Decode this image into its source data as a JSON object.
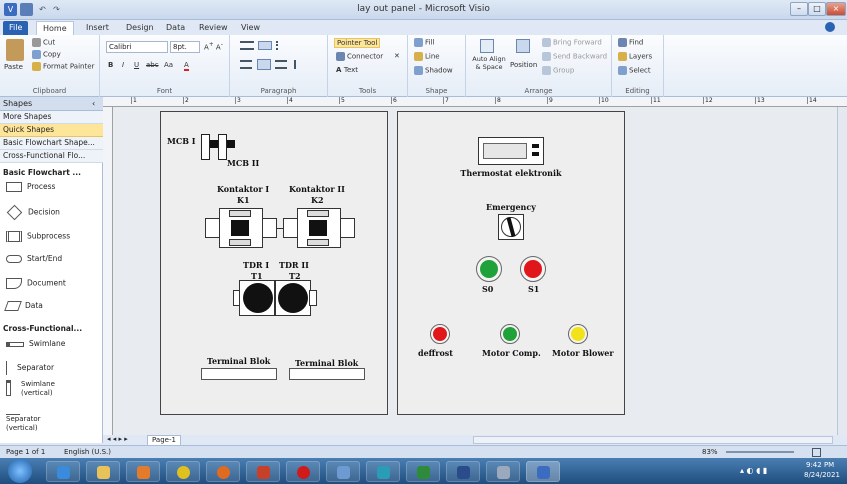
{
  "window": {
    "title": "lay out panel - Microsoft Visio"
  },
  "quick_access": [
    "V",
    "save",
    "undo",
    "redo"
  ],
  "tabs": [
    "File",
    "Home",
    "Insert",
    "Design",
    "Data",
    "Review",
    "View"
  ],
  "ribbon": {
    "clipboard": {
      "label": "Clipboard",
      "paste": "Paste",
      "cut": "Cut",
      "copy": "Copy",
      "format_painter": "Format Painter"
    },
    "font": {
      "label": "Font",
      "family": "Calibri",
      "size": "8pt.",
      "bold": "B",
      "italic": "I",
      "underline": "U",
      "strike": "abc",
      "case": "Aa",
      "color": "A"
    },
    "paragraph": {
      "label": "Paragraph"
    },
    "tools": {
      "label": "Tools",
      "pointer": "Pointer Tool",
      "connector": "Connector",
      "text": "Text"
    },
    "shape": {
      "label": "Shape",
      "fill": "Fill",
      "line": "Line",
      "shadow": "Shadow"
    },
    "arrange": {
      "label": "Arrange",
      "auto_align": "Auto Align & Space",
      "position": "Position",
      "bring_forward": "Bring Forward",
      "send_backward": "Send Backward",
      "group": "Group"
    },
    "editing": {
      "label": "Editing",
      "find": "Find",
      "layers": "Layers",
      "select": "Select"
    }
  },
  "shapes_pane": {
    "header": "Shapes",
    "stencils": [
      "More Shapes",
      "Quick Shapes",
      "Basic Flowchart Shape...",
      "Cross-Functional Flo..."
    ],
    "basic_section": "Basic Flowchart ...",
    "basic_items": [
      "Process",
      "Decision",
      "Subprocess",
      "Start/End",
      "Document",
      "Data"
    ],
    "cross_section": "Cross-Functional...",
    "cross_items": [
      "Swimlane",
      "Separator",
      "Swimlane (vertical)",
      "Separator (vertical)"
    ]
  },
  "ruler_marks": [
    "1",
    "2",
    "3",
    "4",
    "5",
    "6",
    "7",
    "8",
    "9",
    "10",
    "11",
    "12",
    "13",
    "14"
  ],
  "drawing": {
    "panel1": {
      "mcb1": "MCB I",
      "mcb2": "MCB II",
      "k1_title": "Kontaktor I",
      "k1_id": "K1",
      "k2_title": "Kontaktor II",
      "k2_id": "K2",
      "tdr1": "TDR I",
      "t1": "T1",
      "tdr2": "TDR II",
      "t2": "T2",
      "term1": "Terminal Blok",
      "term2": "Terminal Blok"
    },
    "panel2": {
      "thermostat": "Thermostat elektronik",
      "emergency": "Emergency",
      "s0": "S0",
      "s1": "S1",
      "lamp1": "deffrost",
      "lamp2": "Motor Comp.",
      "lamp3": "Motor Blower"
    }
  },
  "page_tab": "Page-1",
  "status": {
    "page": "Page 1 of 1",
    "language": "English (U.S.)",
    "zoom": "83%"
  },
  "clock": {
    "time": "9:42 PM",
    "date": "8/24/2021"
  },
  "colors": {
    "green": "#1fa23a",
    "red": "#e0161b",
    "yellow": "#f2e21a",
    "ribbon_blue": "#2a62b3"
  }
}
